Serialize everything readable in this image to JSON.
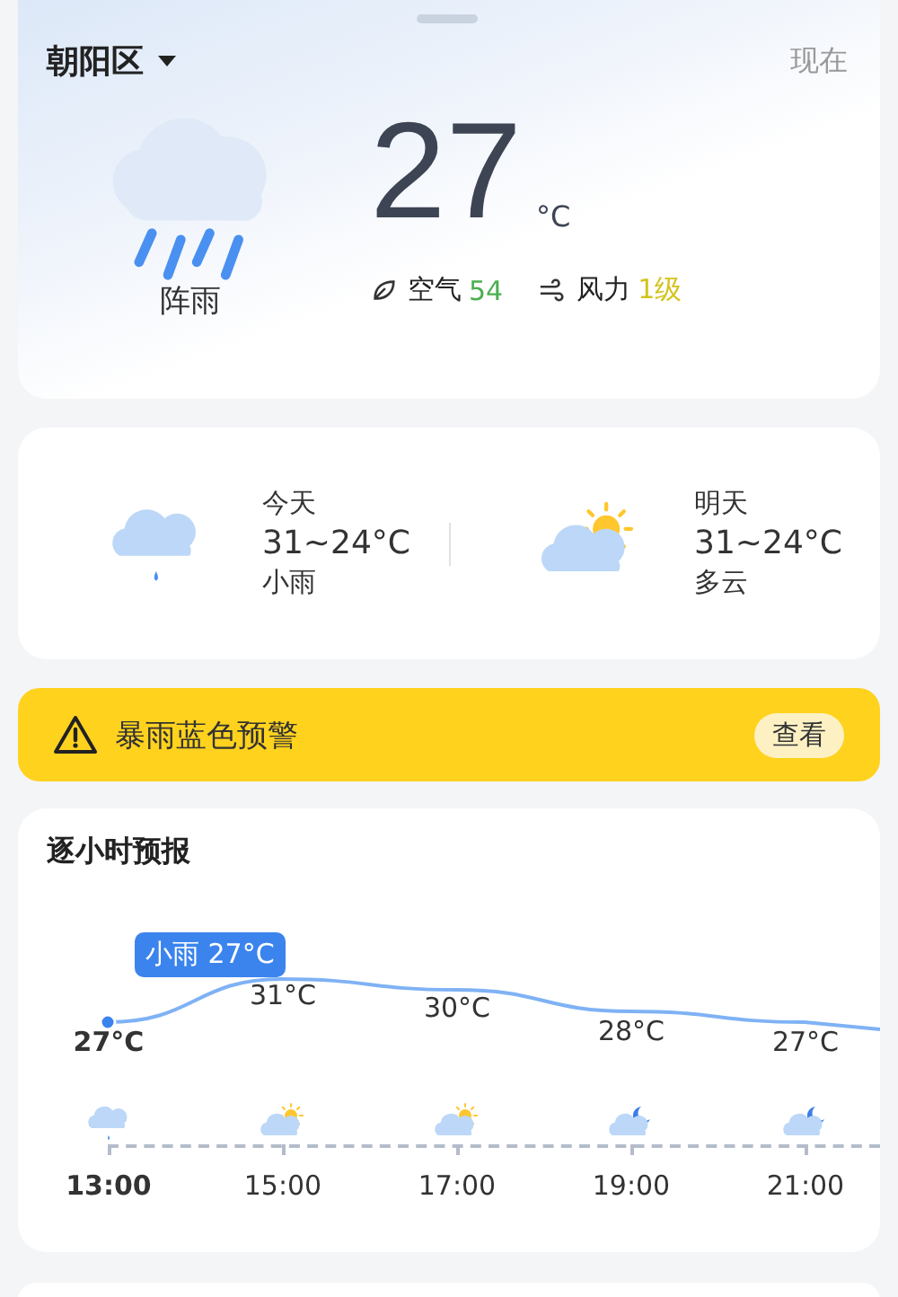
{
  "location": {
    "name": "朝阳区"
  },
  "now_label": "现在",
  "current": {
    "kind": "shower",
    "condition": "阵雨",
    "temp": "27",
    "unit": "°C",
    "air_label": "空气",
    "air_value": "54",
    "wind_label": "风力",
    "wind_value": "1级"
  },
  "daily": [
    {
      "kind": "light_rain",
      "day": "今天",
      "range": "31~24°C",
      "condition": "小雨"
    },
    {
      "kind": "partly_sunny",
      "day": "明天",
      "range": "31~24°C",
      "condition": "多云"
    }
  ],
  "alert": {
    "text": "暴雨蓝色预警",
    "button": "查看"
  },
  "hourly": {
    "title": "逐小时预报",
    "tooltip": "小雨 27°C",
    "hours": [
      {
        "temp": "27°C",
        "kind": "light_rain",
        "time": "13:00",
        "selected": true
      },
      {
        "temp": "31°C",
        "kind": "partly_sunny",
        "time": "15:00",
        "selected": false
      },
      {
        "temp": "30°C",
        "kind": "partly_sunny",
        "time": "17:00",
        "selected": false
      },
      {
        "temp": "28°C",
        "kind": "moon_cloudy",
        "time": "19:00",
        "selected": false
      },
      {
        "temp": "27°C",
        "kind": "moon_cloudy",
        "time": "21:00",
        "selected": false
      }
    ]
  }
}
